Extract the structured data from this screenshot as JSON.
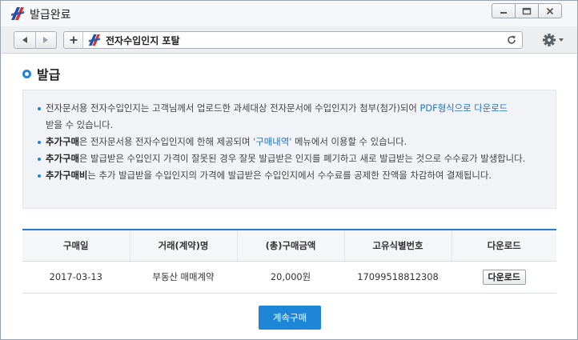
{
  "window": {
    "title": "발급완료"
  },
  "toolbar": {
    "address_text": "전자수입인지 포탈"
  },
  "section": {
    "title": "발급"
  },
  "info": {
    "items": [
      {
        "prefix": "",
        "text": "전자문서용 전자수입인지는 고객님께서 업로드한 과세대상 전자문서에 수입인지가 첨부(첨가)되어 ",
        "link": "PDF형식으로 다운로드",
        "tail": "받을 수 있습니다."
      },
      {
        "prefix": "추가구매",
        "text": "은 전자문서용 전자수입인지에 한해 제공되며 ",
        "link": "'구매내역'",
        "tail": " 메뉴에서 이용할 수 있습니다."
      },
      {
        "prefix": "추가구매",
        "text": "은 발급받은 수입인지 가격이 잘못된 경우 잘못 발급받은 인지를 폐기하고 새로 발급받는 것으로 수수료가 발생합니다."
      },
      {
        "prefix": "추가구매비",
        "text": "는 추가 발급받을 수입인지의 가격에 발급받은 수입인지에서 수수료를 공제한 잔액을 차감하여 결제됩니다."
      }
    ]
  },
  "table": {
    "headers": [
      "구매일",
      "거래(계약)명",
      "(총)구매금액",
      "고유식별번호",
      "다운로드"
    ],
    "rows": [
      {
        "date": "2017-03-13",
        "name": "부동산 매매계약",
        "amount": "20,000원",
        "id": "17099518812308",
        "download_label": "다운로드"
      }
    ]
  },
  "actions": {
    "continue_label": "계속구매"
  },
  "colors": {
    "accent": "#1e86d6",
    "link": "#1e73c8",
    "box_bg": "#f1f3f6"
  }
}
